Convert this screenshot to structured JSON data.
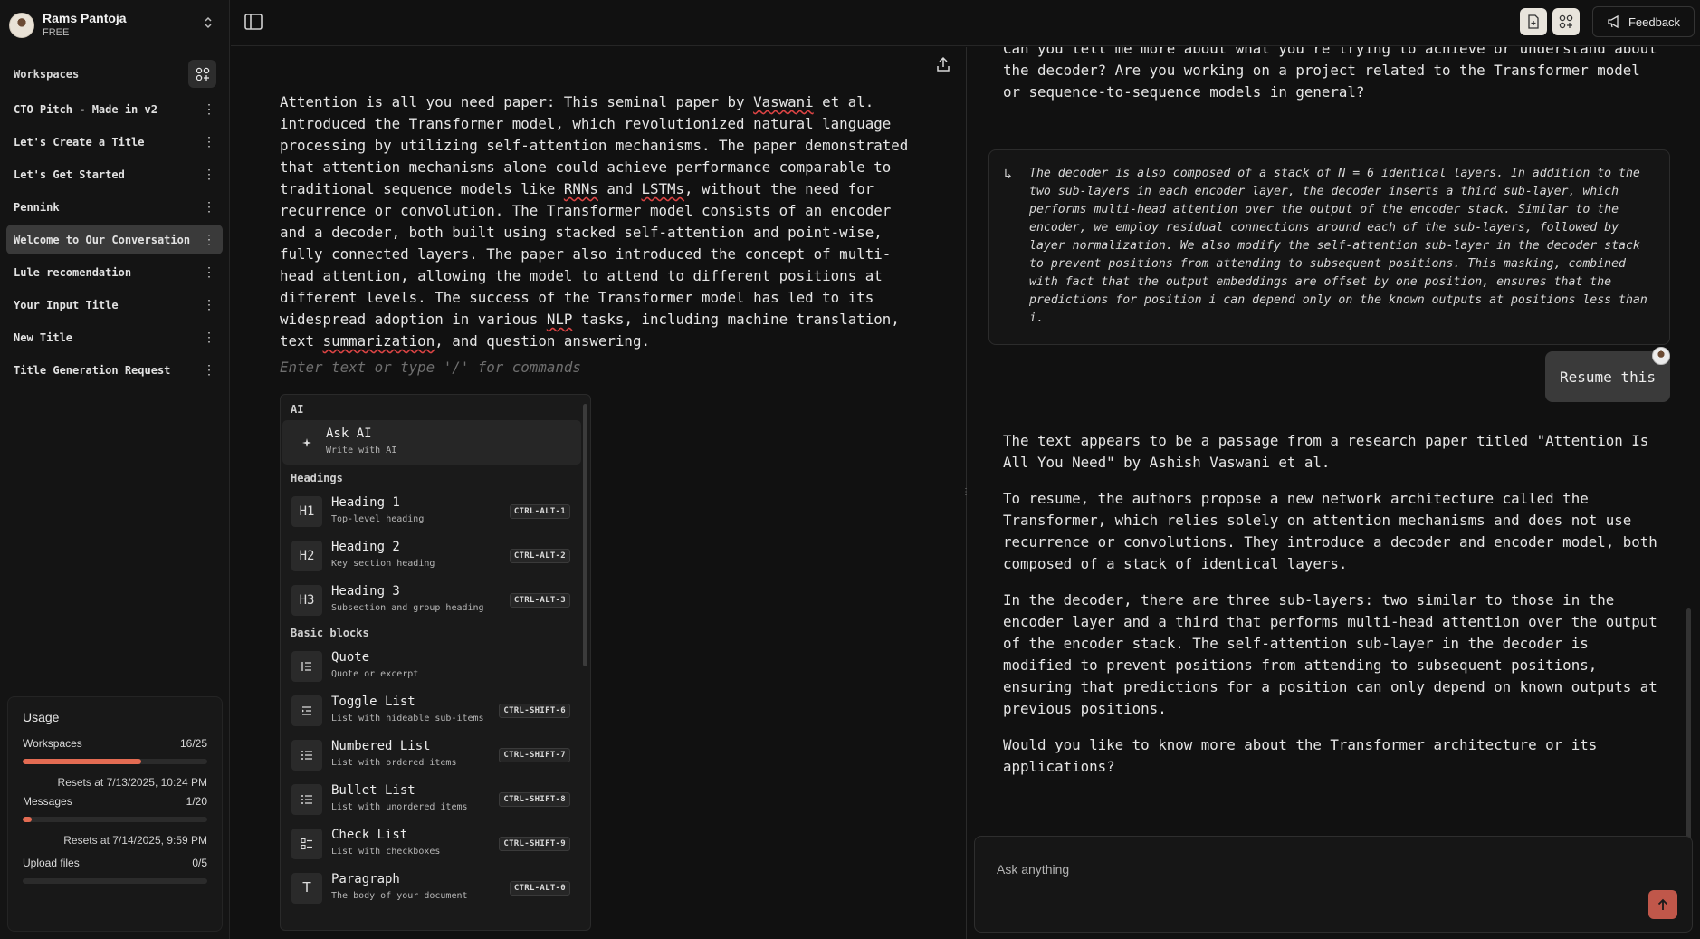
{
  "user": {
    "name": "Rams Pantoja",
    "plan": "FREE"
  },
  "sidebar": {
    "workspaces_label": "Workspaces",
    "items": [
      {
        "label": "CTO Pitch - Made in v2"
      },
      {
        "label": "Let's Create a Title"
      },
      {
        "label": "Let's Get Started"
      },
      {
        "label": "Pennink"
      },
      {
        "label": "Welcome to Our Conversation"
      },
      {
        "label": "Lule recomendation"
      },
      {
        "label": "Your Input Title"
      },
      {
        "label": "New Title"
      },
      {
        "label": "Title Generation Request"
      }
    ],
    "active_index": 4
  },
  "usage": {
    "title": "Usage",
    "workspaces": {
      "label": "Workspaces",
      "value": "16/25",
      "fraction": 0.64,
      "reset": "Resets at 7/13/2025, 10:24 PM"
    },
    "messages": {
      "label": "Messages",
      "value": "1/20",
      "fraction": 0.05,
      "reset": "Resets at 7/14/2025, 9:59 PM"
    },
    "upload": {
      "label": "Upload files",
      "value": "0/5",
      "fraction": 0
    }
  },
  "topbar": {
    "feedback_label": "Feedback"
  },
  "editor": {
    "paragraph_segments": [
      "Attention is all you need paper: This seminal paper by ",
      "Vaswani",
      " et al. introduced the Transformer model, which revolutionized natural language processing by utilizing self-attention mechanisms. The paper demonstrated that attention mechanisms alone could achieve performance comparable to traditional sequence models like ",
      "RNNs",
      " and ",
      "LSTMs",
      ", without the need for recurrence or convolution. The Transformer model consists of an encoder and a decoder, both built using stacked self-attention and point-wise, fully connected layers. The paper also introduced the concept of multi-head attention, allowing the model to attend to different positions at different levels. The success of the Transformer model has led to its widespread adoption in various ",
      "NLP",
      " tasks, including machine translation, text ",
      "summarization",
      ", and question answering."
    ],
    "placeholder": "Enter text or type '/' for commands"
  },
  "slash_menu": {
    "sections": {
      "ai": "AI",
      "headings": "Headings",
      "basic": "Basic blocks"
    },
    "ask_ai": {
      "title": "Ask AI",
      "desc": "Write with AI"
    },
    "headings": [
      {
        "title": "Heading 1",
        "desc": "Top-level heading",
        "kbd": "CTRL-ALT-1",
        "glyph": "H1"
      },
      {
        "title": "Heading 2",
        "desc": "Key section heading",
        "kbd": "CTRL-ALT-2",
        "glyph": "H2"
      },
      {
        "title": "Heading 3",
        "desc": "Subsection and group heading",
        "kbd": "CTRL-ALT-3",
        "glyph": "H3"
      }
    ],
    "basic": [
      {
        "title": "Quote",
        "desc": "Quote or excerpt",
        "kbd": "",
        "icon": "quote-icon"
      },
      {
        "title": "Toggle List",
        "desc": "List with hideable sub-items",
        "kbd": "CTRL-SHIFT-6",
        "icon": "toggle-list-icon"
      },
      {
        "title": "Numbered List",
        "desc": "List with ordered items",
        "kbd": "CTRL-SHIFT-7",
        "icon": "numbered-list-icon"
      },
      {
        "title": "Bullet List",
        "desc": "List with unordered items",
        "kbd": "CTRL-SHIFT-8",
        "icon": "bullet-list-icon"
      },
      {
        "title": "Check List",
        "desc": "List with checkboxes",
        "kbd": "CTRL-SHIFT-9",
        "icon": "check-list-icon"
      },
      {
        "title": "Paragraph",
        "desc": "The body of your document",
        "kbd": "CTRL-ALT-0",
        "icon": "paragraph-icon"
      }
    ]
  },
  "chat": {
    "top_text": "Can you tell me more about what you're trying to achieve or understand about the decoder? Are you working on a project related to the Transformer model or sequence-to-sequence models in general?",
    "quote": "The decoder is also composed of a stack of N = 6 identical layers. In addition to the two sub-layers in each encoder layer, the decoder inserts a third sub-layer, which performs multi-head attention over the output of the encoder stack. Similar to the encoder, we employ residual connections around each of the sub-layers, followed by layer normalization. We also modify the self-attention sub-layer in the decoder stack to prevent positions from attending to subsequent positions. This masking, combined with fact that the output embeddings are offset by one position, ensures that the predictions for position i can depend only on the known outputs at positions less than i.",
    "user_message": "Resume this",
    "reply": [
      "The text appears to be a passage from a research paper titled \"Attention Is All You Need\" by Ashish Vaswani et al.",
      "To resume, the authors propose a new network architecture called the Transformer, which relies solely on attention mechanisms and does not use recurrence or convolutions. They introduce a decoder and encoder model, both composed of a stack of identical layers.",
      "In the decoder, there are three sub-layers: two similar to those in the encoder layer and a third that performs multi-head attention over the output of the encoder stack. The self-attention sub-layer in the decoder is modified to prevent positions from attending to subsequent positions, ensuring that predictions for a position can only depend on known outputs at previous positions.",
      "Would you like to know more about the Transformer architecture or its applications?"
    ],
    "input_placeholder": "Ask anything"
  },
  "colors": {
    "accent": "#e36b52",
    "send": "#c0574a",
    "background": "#111111"
  }
}
